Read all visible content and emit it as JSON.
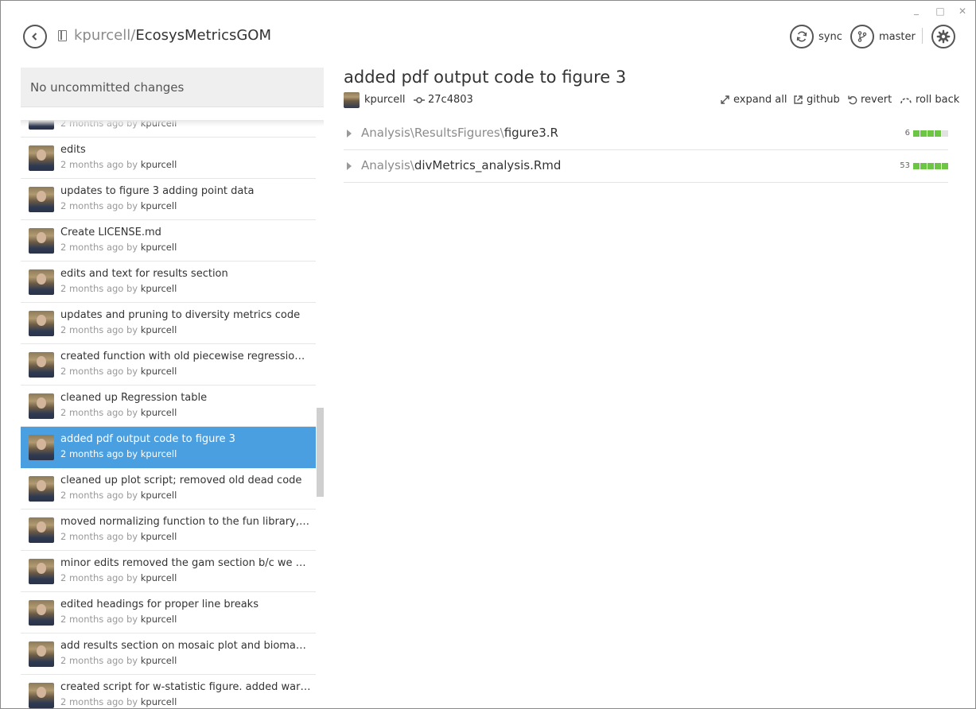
{
  "header": {
    "repo_owner": "kpurcell",
    "repo_separator": "/",
    "repo_name": "EcosysMetricsGOM",
    "sync_label": "sync",
    "branch_label": "master"
  },
  "sidebar": {
    "uncommitted": "No uncommitted changes",
    "partial_top": {
      "time": "2 months ago by",
      "user": "kpurcell"
    },
    "commits": [
      {
        "message": "edits",
        "time": "2 months ago by",
        "user": "kpurcell"
      },
      {
        "message": "updates to figure 3 adding point data",
        "time": "2 months ago by",
        "user": "kpurcell"
      },
      {
        "message": "Create LICENSE.md",
        "time": "2 months ago by",
        "user": "kpurcell"
      },
      {
        "message": "edits and text for results section",
        "time": "2 months ago by",
        "user": "kpurcell"
      },
      {
        "message": "updates and pruning to diversity metrics code",
        "time": "2 months ago by",
        "user": "kpurcell"
      },
      {
        "message": "created function with old piecewise regression sc...",
        "time": "2 months ago by",
        "user": "kpurcell"
      },
      {
        "message": "cleaned up Regression table",
        "time": "2 months ago by",
        "user": "kpurcell"
      },
      {
        "message": "added pdf output code to figure 3",
        "time": "2 months ago by",
        "user": "kpurcell",
        "selected": true
      },
      {
        "message": "cleaned up plot script; removed old dead code",
        "time": "2 months ago by",
        "user": "kpurcell"
      },
      {
        "message": "moved normalizing function to the fun library, a...",
        "time": "2 months ago by",
        "user": "kpurcell"
      },
      {
        "message": "minor edits removed the gam section b/c we will...",
        "time": "2 months ago by",
        "user": "kpurcell"
      },
      {
        "message": "edited headings for proper line breaks",
        "time": "2 months ago by",
        "user": "kpurcell"
      },
      {
        "message": "add results section on mosaic plot and biomass t...",
        "time": "2 months ago by",
        "user": "kpurcell"
      },
      {
        "message": "created script for w-statistic figure.  added warwi...",
        "time": "2 months ago by",
        "user": "kpurcell"
      }
    ]
  },
  "detail": {
    "title": "added pdf output code to figure 3",
    "author": "kpurcell",
    "sha": "27c4803",
    "actions": {
      "expand_all": "expand all",
      "github": "github",
      "revert": "revert",
      "roll_back": "roll back"
    },
    "files": [
      {
        "dir": "Analysis\\ResultsFigures\\",
        "name": "figure3.R",
        "changes": "6",
        "additions_fraction": 0.8
      },
      {
        "dir": "Analysis\\",
        "name": "divMetrics_analysis.Rmd",
        "changes": "53",
        "additions_fraction": 1.0
      }
    ]
  },
  "colors": {
    "selected": "#4a9fe0",
    "addition": "#6cc644",
    "neutral": "#e1e1e1"
  }
}
